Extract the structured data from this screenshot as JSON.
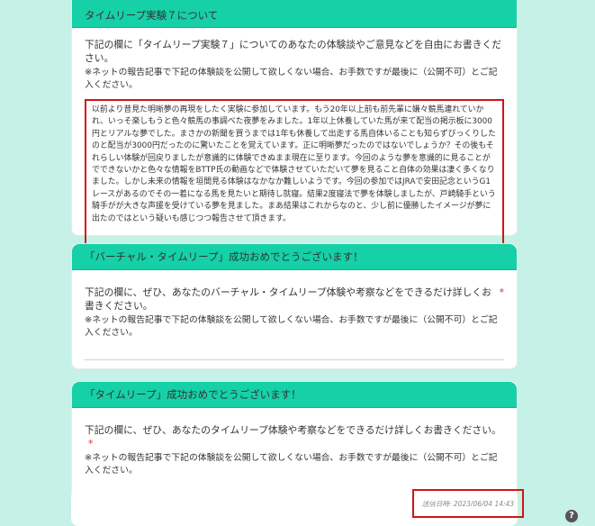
{
  "section1": {
    "header": "タイムリープ実験７について",
    "question": "下記の欄に「タイムリープ実験７」についてのあなたの体験談やご意見などを自由にお書きください。",
    "note": "※ネットの報告記事で下記の体験談を公開して欲しくない場合、お手数ですが最後に（公開不可）とご記入ください。",
    "answer": "以前より昔見た明晰夢の再現をしたく実験に参加しています。もう20年以上前も前先輩に嫌々競馬連れていかれ、いっそ楽しもうと色々競馬の事調べた夜夢をみました。1年以上休養していた馬が来て配当の掲示板に3000円とリアルな夢でした。まさかの新聞を買うまでは1年も休養して出走する馬自体いることも知らずびっくりしたのと配当が3000円だったのに驚いたことを覚えています。正に明晰夢だったのではないでしょうか？その後もそれらしい体験が回戻りましたが意識的に体験できぬまま現在に至ります。今回のような夢を意識的に見ることがでできないかと色々な情報をBTTP氏の動画などで体験させていただいて夢を見ること自体の効果は凄く多くなりました。しかし未来の情報を垣間見る体験はなかなか難しいようです。今回の参加ではJRAで安田記念というG1レースがあるのでその一着になる馬を見たいと期待し就寝。結果2度寝法で夢を体験しましたが、戸崎騎手という騎手がが大きな声援を受けている夢を見ました。まあ結果はこれからなのと、少し前に優勝したイメージが夢に出たのではという疑いも感じつつ報告させて頂きます。"
  },
  "section2": {
    "header": "「バーチャル・タイムリープ」成功おめでとうございます！",
    "question": "下記の欄に、ぜひ、あなたのバーチャル・タイムリープ体験や考察などをできるだけ詳しくお書きください。",
    "required": "*",
    "note": "※ネットの報告記事で下記の体験談を公開して欲しくない場合、お手数ですが最後に（公開不可）とご記入ください。"
  },
  "section3": {
    "header": "「タイムリープ」成功おめでとうございます！",
    "question": "下記の欄に、ぜひ、あなたのタイムリープ体験や考察などをできるだけ詳しくお書きください。",
    "required": "*",
    "note": "※ネットの報告記事で下記の体験談を公開して欲しくない場合、お手数ですが最後に（公開不可）とご記入ください。"
  },
  "footer": {
    "sent_label": "送信日時: 2023/06/04 14:43"
  },
  "help": {
    "label": "?"
  }
}
